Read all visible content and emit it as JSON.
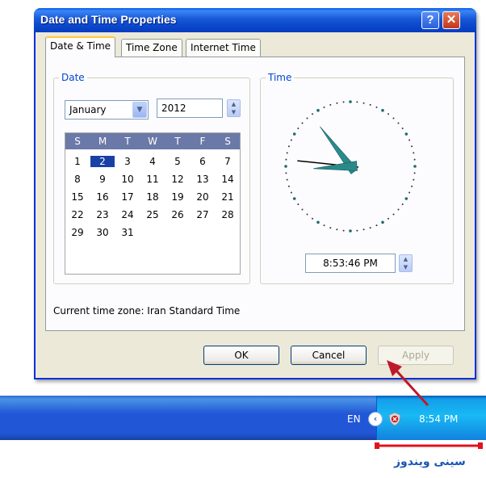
{
  "window": {
    "title": "Date and Time Properties",
    "help_glyph": "?",
    "close_glyph": "✕"
  },
  "tabs": [
    "Date & Time",
    "Time Zone",
    "Internet Time"
  ],
  "date_group": {
    "label": "Date",
    "month": "January",
    "year": "2012",
    "weekday_headers": [
      "S",
      "M",
      "T",
      "W",
      "T",
      "F",
      "S"
    ],
    "weeks": [
      [
        "1",
        "2",
        "3",
        "4",
        "5",
        "6",
        "7"
      ],
      [
        "8",
        "9",
        "10",
        "11",
        "12",
        "13",
        "14"
      ],
      [
        "15",
        "16",
        "17",
        "18",
        "19",
        "20",
        "21"
      ],
      [
        "22",
        "23",
        "24",
        "25",
        "26",
        "27",
        "28"
      ],
      [
        "29",
        "30",
        "31",
        "",
        "",
        "",
        ""
      ]
    ],
    "selected_day": "2"
  },
  "time_group": {
    "label": "Time",
    "time_value": "8:53:46 PM",
    "clock": {
      "hour": 8,
      "minute": 53,
      "second": 46
    }
  },
  "current_timezone": "Current time zone: Iran Standard Time",
  "buttons": {
    "ok": "OK",
    "cancel": "Cancel",
    "apply": "Apply"
  },
  "taskbar": {
    "language": "EN",
    "chevron": "‹",
    "clock": "8:54 PM"
  },
  "caption": "سینی ویندوز",
  "colors": {
    "title_blue": "#0a4fd9",
    "annotation_red": "#c0182a",
    "caption_blue": "#1a57b4",
    "clock_hand": "#2a8a8a"
  }
}
